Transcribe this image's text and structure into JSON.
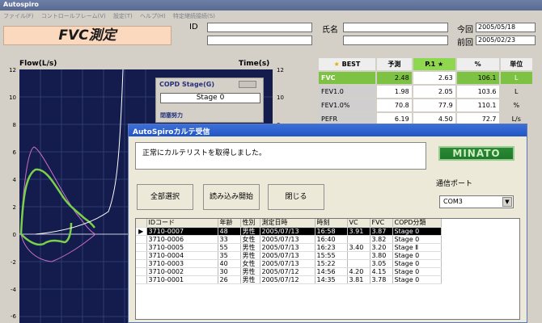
{
  "window": {
    "title": "Autospiro"
  },
  "menu": [
    "ファイル(F)",
    "コントロールフレーム(V)",
    "設定(T)",
    "ヘルプ(H)",
    "特定継続接続(S)"
  ],
  "header": {
    "fvc_title": "FVC測定",
    "id_label": "ID",
    "name_label": "氏名",
    "today_label": "今回",
    "today_value": "2005/05/18",
    "prev_label": "前回",
    "prev_value": "2005/02/23"
  },
  "graph": {
    "left_label": "Flow(L/s)",
    "right_label": "Time(s)",
    "y_left": [
      "12",
      "10",
      "8",
      "6",
      "4",
      "2",
      "0",
      "-2",
      "-4",
      "-6"
    ],
    "y_right": [
      "12",
      "10",
      "8"
    ]
  },
  "copd_panel": {
    "title": "COPD Stage(G)",
    "value": "Stage 0",
    "sub": "閉塞努力"
  },
  "results": {
    "headers": [
      "BEST",
      "予測",
      "P.1",
      "%",
      "単位"
    ],
    "rows": [
      {
        "name": "FVC",
        "pred": "2.48",
        "p1": "2.63",
        "pct": "106.1",
        "unit": "L"
      },
      {
        "name": "FEV1.0",
        "pred": "1.98",
        "p1": "2.05",
        "pct": "103.6",
        "unit": "L"
      },
      {
        "name": "FEV1.0%",
        "pred": "70.8",
        "p1": "77.9",
        "pct": "110.1",
        "unit": "%"
      },
      {
        "name": "PEFR",
        "pred": "6.19",
        "p1": "4.50",
        "pct": "72.7",
        "unit": "L/s"
      }
    ]
  },
  "dialog": {
    "title": "AutoSpiroカルテ受信",
    "message": "正常にカルテリストを取得しました。",
    "logo": "MINATO",
    "buttons": [
      "全部選択",
      "読み込み開始",
      "閉じる"
    ],
    "port_label": "通信ポート",
    "port_value": "COM3",
    "columns": [
      "IDコード",
      "年齢",
      "性別",
      "測定日時",
      "時刻",
      "VC",
      "FVC",
      "COPD分類"
    ],
    "rows": [
      {
        "id": "3710-0007",
        "age": "48",
        "sex": "男性",
        "date": "2005/07/13",
        "time": "16:58",
        "vc": "3.91",
        "fvc": "3.87",
        "copd": "Stage 0"
      },
      {
        "id": "3710-0006",
        "age": "33",
        "sex": "女性",
        "date": "2005/07/13",
        "time": "16:40",
        "vc": "",
        "fvc": "3.82",
        "copd": "Stage 0"
      },
      {
        "id": "3710-0005",
        "age": "55",
        "sex": "男性",
        "date": "2005/07/13",
        "time": "16:23",
        "vc": "3.40",
        "fvc": "3.20",
        "copd": "Stage Ⅱ"
      },
      {
        "id": "3710-0004",
        "age": "35",
        "sex": "男性",
        "date": "2005/07/13",
        "time": "15:55",
        "vc": "",
        "fvc": "3.80",
        "copd": "Stage 0"
      },
      {
        "id": "3710-0003",
        "age": "40",
        "sex": "女性",
        "date": "2005/07/13",
        "time": "15:22",
        "vc": "",
        "fvc": "3.05",
        "copd": "Stage 0"
      },
      {
        "id": "3710-0002",
        "age": "30",
        "sex": "男性",
        "date": "2005/07/12",
        "time": "14:56",
        "vc": "4.20",
        "fvc": "4.15",
        "copd": "Stage 0"
      },
      {
        "id": "3710-0001",
        "age": "26",
        "sex": "男性",
        "date": "2005/07/12",
        "time": "14:35",
        "vc": "3.81",
        "fvc": "3.78",
        "copd": "Stage 0"
      }
    ]
  }
}
